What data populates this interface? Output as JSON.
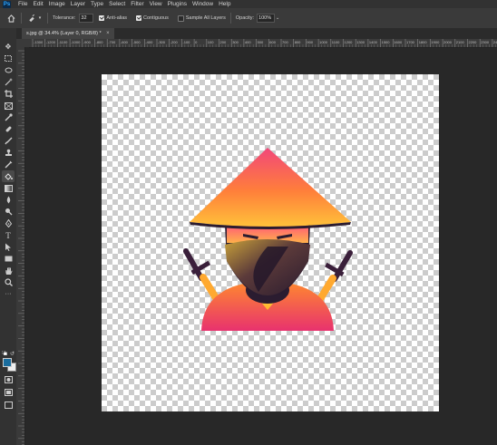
{
  "menubar": {
    "app_logo": "Ps",
    "items": [
      "File",
      "Edit",
      "Image",
      "Layer",
      "Type",
      "Select",
      "Filter",
      "View",
      "Plugins",
      "Window",
      "Help"
    ]
  },
  "options": {
    "tolerance_label": "Tolerance:",
    "tolerance_value": "32",
    "anti_alias_label": "Anti-alias",
    "anti_alias_checked": true,
    "contiguous_label": "Contiguous",
    "contiguous_checked": true,
    "sample_all_layers_label": "Sample All Layers",
    "sample_all_layers_checked": false,
    "opacity_label": "Opacity:",
    "opacity_value": "100%"
  },
  "document": {
    "tab_title": "s.jpg @ 34.4% (Layer 0, RGB/8) *",
    "close_glyph": "×"
  },
  "ruler": {
    "ticks": [
      "-1300",
      "-1200",
      "-1100",
      "-1000",
      "-900",
      "-800",
      "-700",
      "-600",
      "-500",
      "-400",
      "-300",
      "-200",
      "-100",
      "0",
      "100",
      "200",
      "300",
      "400",
      "500",
      "600",
      "700",
      "800",
      "900",
      "1000",
      "1100",
      "1200",
      "1300",
      "1400",
      "1500",
      "1600",
      "1700",
      "1800",
      "1900",
      "2000",
      "2100",
      "2200",
      "2300",
      "2400"
    ]
  },
  "toolbar": {
    "tools": [
      "move-icon",
      "marquee-icon",
      "lasso-icon",
      "magic-wand-icon",
      "crop-icon",
      "frame-icon",
      "eyedropper-icon",
      "healing-icon",
      "brush-icon",
      "stamp-icon",
      "history-brush-icon",
      "eraser-icon",
      "gradient-icon",
      "blur-icon",
      "dodge-icon",
      "pen-icon",
      "type-icon",
      "path-select-icon",
      "rectangle-icon",
      "hand-icon",
      "zoom-icon",
      "more-icon"
    ],
    "active_tool": "paint-bucket-icon",
    "foreground_color": "#1a6d9e",
    "background_color": "#f0f0f0"
  },
  "colors": {
    "app_bg": "#282828",
    "panel_bg": "#323232",
    "accent": "#31a8ff"
  }
}
